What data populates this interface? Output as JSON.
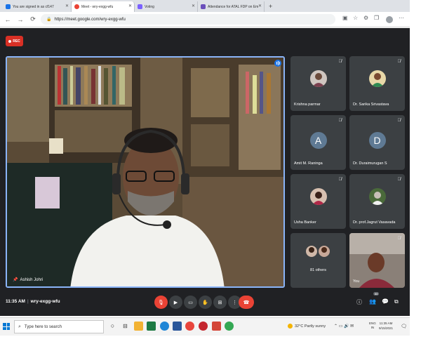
{
  "browser": {
    "tabs": [
      {
        "label": "You are signed in as cf147",
        "favicon_color": "#1a73e8",
        "active": false
      },
      {
        "label": "Meet - wry-exgg-wfu",
        "favicon_color": "#ea4335",
        "active": true
      },
      {
        "label": "Voting",
        "favicon_color": "#7b61ff",
        "active": false
      },
      {
        "label": "Attendance for ATAL FDP on Em",
        "favicon_color": "#6b4fbb",
        "active": false
      }
    ],
    "url": "https://meet.google.com/wry-exgg-wfu",
    "new_tab_symbol": "+",
    "nav_icons": {
      "back": "←",
      "forward": "→",
      "reload": "⟳"
    }
  },
  "meet": {
    "rec_label": "REC",
    "main_speaker": "Ashish Johri",
    "participants": [
      {
        "name": "Krishna parmar",
        "type": "photo",
        "color": "#8a6a55"
      },
      {
        "name": "Dr. Sarika Srivastava",
        "type": "photo",
        "color": "#c78a3a"
      },
      {
        "name": "Amit M. Raninga",
        "type": "initial",
        "initial": "A",
        "color": "#5f7a94"
      },
      {
        "name": "Dr. Duraimurugan S",
        "type": "initial",
        "initial": "D",
        "color": "#5f7a94"
      },
      {
        "name": "Usha Banker",
        "type": "photo",
        "color": "#a0522d"
      },
      {
        "name": "Dr. prof.Jagrut Vasavada",
        "type": "photo",
        "color": "#5a7a4a"
      }
    ],
    "others_label": "81 others",
    "self_label": "You",
    "time": "11:35 AM",
    "separator": "|",
    "meeting_code": "wry-exgg-wfu",
    "people_badge": "88"
  },
  "taskbar": {
    "search_placeholder": "Type here to search",
    "weather": "32°C  Partly sunny",
    "lang_line1": "ENG",
    "lang_line2": "IN",
    "clock_time": "11:35 AM",
    "clock_date": "9/15/2021"
  },
  "colors": {
    "meet_bg": "#202124",
    "tile_bg": "#3c4043",
    "accent_blue": "#8ab4f8",
    "danger_red": "#ea4335"
  }
}
